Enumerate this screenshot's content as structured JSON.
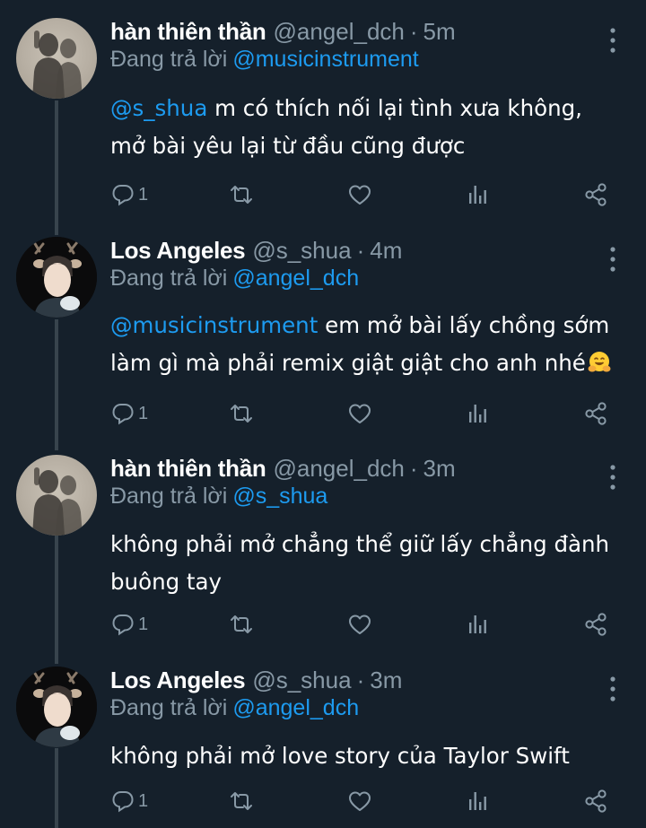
{
  "tweets": [
    {
      "name": "hàn thiên thần",
      "handle": "@angel_dch",
      "separator": "·",
      "time": "5m",
      "reply_prefix": "Đang trả lời",
      "reply_to": "@musicinstrument",
      "mention": "@s_shua",
      "text_line1": " m có thích nối lại tình xưa không,",
      "text_line2": "mở bài yêu lại từ đầu cũng được",
      "reply_count": "1",
      "avatar_icon": "shadow-photo-avatar"
    },
    {
      "name": "Los Angeles",
      "handle": "@s_shua",
      "separator": "·",
      "time": "4m",
      "reply_prefix": "Đang trả lời",
      "reply_to": "@angel_dch",
      "mention": "@musicinstrument",
      "text_line1": " em mở bài lấy chồng sớm",
      "text_line2": "làm gì mà phải remix giật giật cho anh nhé",
      "emoji": "hugging-face-emoji",
      "reply_count": "1",
      "avatar_icon": "person-with-deer-ears-avatar"
    },
    {
      "name": "hàn thiên thần",
      "handle": "@angel_dch",
      "separator": "·",
      "time": "3m",
      "reply_prefix": "Đang trả lời",
      "reply_to": "@s_shua",
      "text_line1": "không phải mở chẳng thể giữ lấy chẳng đành",
      "text_line2": "buông tay",
      "reply_count": "1",
      "avatar_icon": "shadow-photo-avatar"
    },
    {
      "name": "Los Angeles",
      "handle": "@s_shua",
      "separator": "·",
      "time": "3m",
      "reply_prefix": "Đang trả lời",
      "reply_to": "@angel_dch",
      "text_line1": "không phải mở love story của Taylor Swift",
      "reply_count": "1",
      "avatar_icon": "person-with-deer-ears-avatar"
    }
  ],
  "colors": {
    "background": "#15202b",
    "secondary_text": "#8899a6",
    "link": "#1d9bf0",
    "thread_line": "#38444d"
  }
}
